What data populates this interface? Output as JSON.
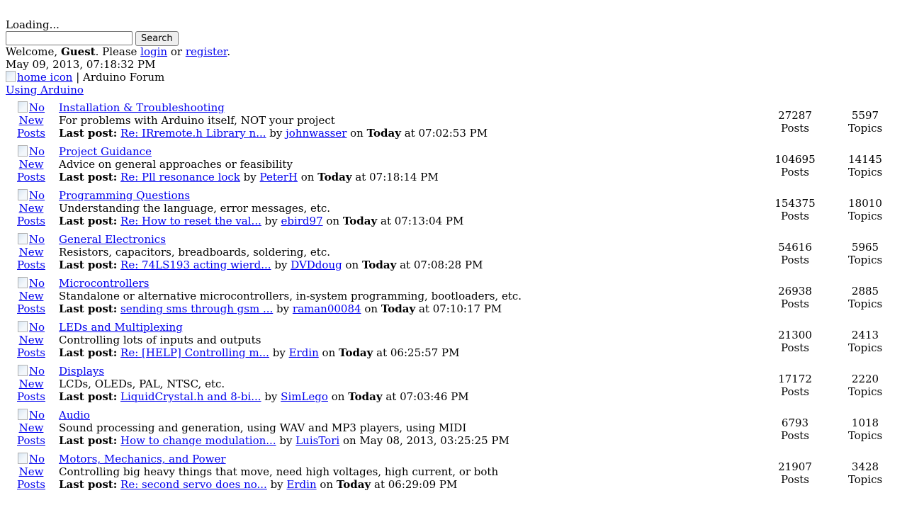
{
  "header": {
    "loading_text": "Loading...",
    "search_placeholder": "",
    "search_value": "",
    "search_button": "Search",
    "welcome_prefix": "Welcome, ",
    "welcome_user": "Guest",
    "welcome_mid": ". Please ",
    "login_link": "login",
    "or_text": " or ",
    "register_link": "register",
    "period": ".",
    "datetime": "May 09, 2013, 07:18:32 PM",
    "home_icon_alt": "home icon",
    "separator": " | ",
    "forum_name": "Arduino Forum",
    "category_link": "Using Arduino"
  },
  "labels": {
    "no_new_posts": "No New Posts",
    "no_word": "No",
    "new_word": "New",
    "posts_word": "Posts",
    "last_post": "Last post:",
    "by": " by ",
    "on": " on ",
    "at": " at ",
    "posts_label": "Posts",
    "topics_label": "Topics"
  },
  "boards": [
    {
      "name": "Installation & Troubleshooting",
      "description": "For problems with Arduino itself, NOT your project",
      "last_post_title": "Re: IRremote.h Library n...",
      "last_post_user": "johnwasser",
      "last_post_day": "Today",
      "last_post_time": "07:02:53 PM",
      "posts": "27287",
      "topics": "5597"
    },
    {
      "name": "Project Guidance",
      "description": "Advice on general approaches or feasibility",
      "last_post_title": "Re: Pll resonance lock",
      "last_post_user": "PeterH",
      "last_post_day": "Today",
      "last_post_time": "07:18:14 PM",
      "posts": "104695",
      "topics": "14145"
    },
    {
      "name": "Programming Questions",
      "description": "Understanding the language, error messages, etc.",
      "last_post_title": "Re: How to reset the val...",
      "last_post_user": "ebird97",
      "last_post_day": "Today",
      "last_post_time": "07:13:04 PM",
      "posts": "154375",
      "topics": "18010"
    },
    {
      "name": "General Electronics",
      "description": "Resistors, capacitors, breadboards, soldering, etc.",
      "last_post_title": "Re: 74LS193 acting wierd...",
      "last_post_user": "DVDdoug",
      "last_post_day": "Today",
      "last_post_time": "07:08:28 PM",
      "posts": "54616",
      "topics": "5965"
    },
    {
      "name": "Microcontrollers",
      "description": "Standalone or alternative microcontrollers, in-system programming, bootloaders, etc.",
      "last_post_title": "sending sms through gsm ...",
      "last_post_user": "raman00084",
      "last_post_day": "Today",
      "last_post_time": "07:10:17 PM",
      "posts": "26938",
      "topics": "2885"
    },
    {
      "name": "LEDs and Multiplexing",
      "description": "Controlling lots of inputs and outputs",
      "last_post_title": "Re: [HELP] Controlling m...",
      "last_post_user": "Erdin",
      "last_post_day": "Today",
      "last_post_time": "06:25:57 PM",
      "posts": "21300",
      "topics": "2413"
    },
    {
      "name": "Displays",
      "description": "LCDs, OLEDs, PAL, NTSC, etc.",
      "last_post_title": "LiquidCrystal.h and 8-bi...",
      "last_post_user": "SimLego",
      "last_post_day": "Today",
      "last_post_time": "07:03:46 PM",
      "posts": "17172",
      "topics": "2220"
    },
    {
      "name": "Audio",
      "description": "Sound processing and generation, using WAV and MP3 players, using MIDI",
      "last_post_title": "How to change modulation...",
      "last_post_user": "LuisTori",
      "last_post_day": "May 08, 2013, 03:25:25 PM",
      "last_post_time": "",
      "posts": "6793",
      "topics": "1018"
    },
    {
      "name": "Motors, Mechanics, and Power",
      "description": "Controlling big heavy things that move, need high voltages, high current, or both",
      "last_post_title": "Re: second servo does no...",
      "last_post_user": "Erdin",
      "last_post_day": "Today",
      "last_post_time": "06:29:09 PM",
      "posts": "21907",
      "topics": "3428"
    }
  ]
}
